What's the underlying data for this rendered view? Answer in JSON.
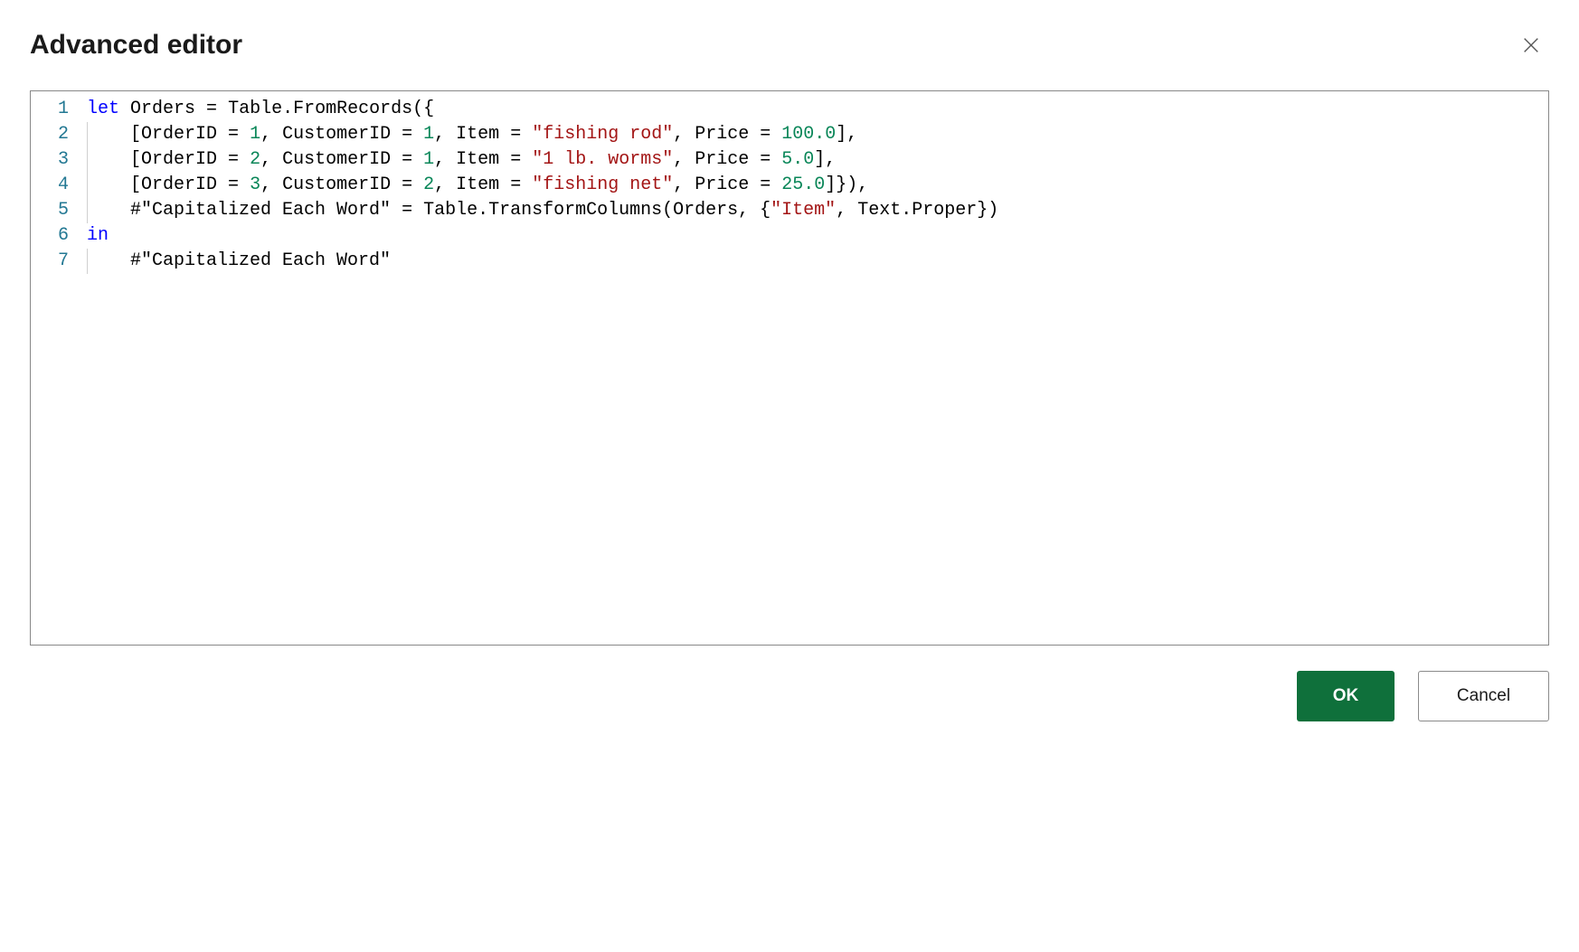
{
  "dialog": {
    "title": "Advanced editor",
    "ok_label": "OK",
    "cancel_label": "Cancel"
  },
  "editor": {
    "lines": [
      {
        "num": "1",
        "indent": 0,
        "tokens": [
          {
            "cls": "tok-keyword",
            "t": "let"
          },
          {
            "cls": "tok-punct",
            "t": " "
          },
          {
            "cls": "tok-ident",
            "t": "Orders"
          },
          {
            "cls": "tok-punct",
            "t": " = "
          },
          {
            "cls": "tok-ident",
            "t": "Table.FromRecords"
          },
          {
            "cls": "tok-punct",
            "t": "({"
          }
        ]
      },
      {
        "num": "2",
        "indent": 1,
        "tokens": [
          {
            "cls": "tok-punct",
            "t": "["
          },
          {
            "cls": "tok-ident",
            "t": "OrderID"
          },
          {
            "cls": "tok-punct",
            "t": " = "
          },
          {
            "cls": "tok-number",
            "t": "1"
          },
          {
            "cls": "tok-punct",
            "t": ", "
          },
          {
            "cls": "tok-ident",
            "t": "CustomerID"
          },
          {
            "cls": "tok-punct",
            "t": " = "
          },
          {
            "cls": "tok-number",
            "t": "1"
          },
          {
            "cls": "tok-punct",
            "t": ", "
          },
          {
            "cls": "tok-ident",
            "t": "Item"
          },
          {
            "cls": "tok-punct",
            "t": " = "
          },
          {
            "cls": "tok-string",
            "t": "\"fishing rod\""
          },
          {
            "cls": "tok-punct",
            "t": ", "
          },
          {
            "cls": "tok-ident",
            "t": "Price"
          },
          {
            "cls": "tok-punct",
            "t": " = "
          },
          {
            "cls": "tok-number",
            "t": "100.0"
          },
          {
            "cls": "tok-punct",
            "t": "],"
          }
        ]
      },
      {
        "num": "3",
        "indent": 1,
        "tokens": [
          {
            "cls": "tok-punct",
            "t": "["
          },
          {
            "cls": "tok-ident",
            "t": "OrderID"
          },
          {
            "cls": "tok-punct",
            "t": " = "
          },
          {
            "cls": "tok-number",
            "t": "2"
          },
          {
            "cls": "tok-punct",
            "t": ", "
          },
          {
            "cls": "tok-ident",
            "t": "CustomerID"
          },
          {
            "cls": "tok-punct",
            "t": " = "
          },
          {
            "cls": "tok-number",
            "t": "1"
          },
          {
            "cls": "tok-punct",
            "t": ", "
          },
          {
            "cls": "tok-ident",
            "t": "Item"
          },
          {
            "cls": "tok-punct",
            "t": " = "
          },
          {
            "cls": "tok-string",
            "t": "\"1 lb. worms\""
          },
          {
            "cls": "tok-punct",
            "t": ", "
          },
          {
            "cls": "tok-ident",
            "t": "Price"
          },
          {
            "cls": "tok-punct",
            "t": " = "
          },
          {
            "cls": "tok-number",
            "t": "5.0"
          },
          {
            "cls": "tok-punct",
            "t": "],"
          }
        ]
      },
      {
        "num": "4",
        "indent": 1,
        "tokens": [
          {
            "cls": "tok-punct",
            "t": "["
          },
          {
            "cls": "tok-ident",
            "t": "OrderID"
          },
          {
            "cls": "tok-punct",
            "t": " = "
          },
          {
            "cls": "tok-number",
            "t": "3"
          },
          {
            "cls": "tok-punct",
            "t": ", "
          },
          {
            "cls": "tok-ident",
            "t": "CustomerID"
          },
          {
            "cls": "tok-punct",
            "t": " = "
          },
          {
            "cls": "tok-number",
            "t": "2"
          },
          {
            "cls": "tok-punct",
            "t": ", "
          },
          {
            "cls": "tok-ident",
            "t": "Item"
          },
          {
            "cls": "tok-punct",
            "t": " = "
          },
          {
            "cls": "tok-string",
            "t": "\"fishing net\""
          },
          {
            "cls": "tok-punct",
            "t": ", "
          },
          {
            "cls": "tok-ident",
            "t": "Price"
          },
          {
            "cls": "tok-punct",
            "t": " = "
          },
          {
            "cls": "tok-number",
            "t": "25.0"
          },
          {
            "cls": "tok-punct",
            "t": "]}),"
          }
        ]
      },
      {
        "num": "5",
        "indent": 1,
        "tokens": [
          {
            "cls": "tok-ident",
            "t": "#\"Capitalized Each Word\""
          },
          {
            "cls": "tok-punct",
            "t": " = "
          },
          {
            "cls": "tok-ident",
            "t": "Table.TransformColumns"
          },
          {
            "cls": "tok-punct",
            "t": "("
          },
          {
            "cls": "tok-ident",
            "t": "Orders"
          },
          {
            "cls": "tok-punct",
            "t": ", {"
          },
          {
            "cls": "tok-string",
            "t": "\"Item\""
          },
          {
            "cls": "tok-punct",
            "t": ", "
          },
          {
            "cls": "tok-ident",
            "t": "Text.Proper"
          },
          {
            "cls": "tok-punct",
            "t": "})"
          }
        ]
      },
      {
        "num": "6",
        "indent": 0,
        "tokens": [
          {
            "cls": "tok-keyword",
            "t": "in"
          }
        ]
      },
      {
        "num": "7",
        "indent": 1,
        "tokens": [
          {
            "cls": "tok-ident",
            "t": "#\"Capitalized Each Word\""
          }
        ]
      }
    ]
  }
}
